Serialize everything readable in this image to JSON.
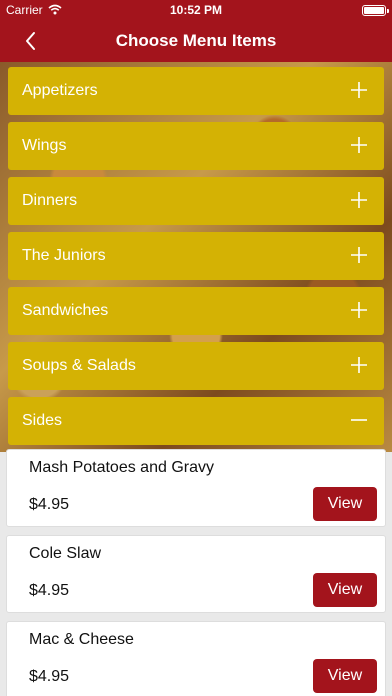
{
  "status_bar": {
    "carrier": "Carrier",
    "time": "10:52 PM"
  },
  "nav": {
    "title": "Choose Menu Items",
    "back_icon": "chevron-left-icon"
  },
  "categories": [
    {
      "label": "Appetizers",
      "state": "collapsed"
    },
    {
      "label": "Wings",
      "state": "collapsed"
    },
    {
      "label": "Dinners",
      "state": "collapsed"
    },
    {
      "label": "The Juniors",
      "state": "collapsed"
    },
    {
      "label": "Sandwiches",
      "state": "collapsed"
    },
    {
      "label": "Soups & Salads",
      "state": "collapsed"
    },
    {
      "label": "Sides",
      "state": "expanded"
    }
  ],
  "items": [
    {
      "name": "Mash Potatoes and Gravy",
      "price": "$4.95",
      "button": "View"
    },
    {
      "name": "Cole Slaw",
      "price": "$4.95",
      "button": "View"
    },
    {
      "name": "Mac & Cheese",
      "price": "$4.95",
      "button": "View"
    }
  ],
  "colors": {
    "brand": "#a3141c",
    "category": "#d4b204"
  }
}
